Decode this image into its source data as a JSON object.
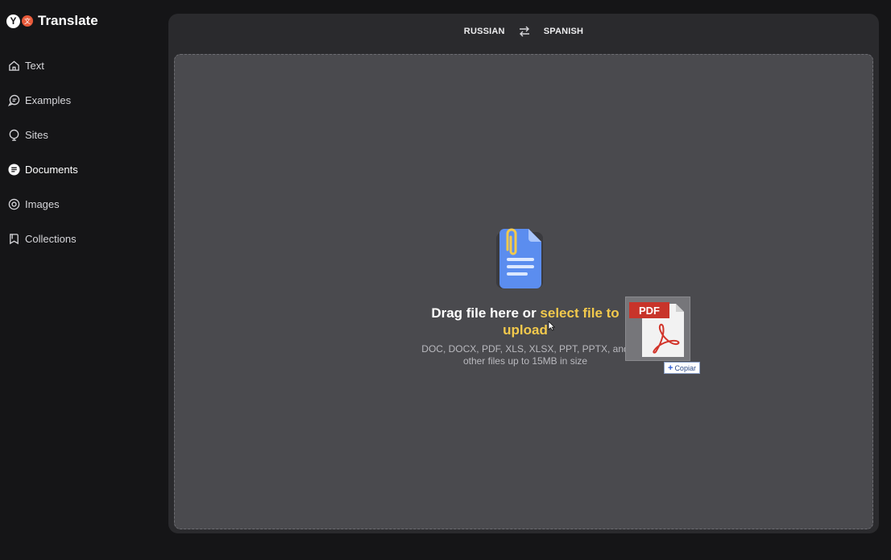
{
  "brand": {
    "title": "Translate",
    "logo_letter": "Y",
    "logo_badge": "文"
  },
  "nav": {
    "items": [
      {
        "label": "Text",
        "icon": "home-icon"
      },
      {
        "label": "Examples",
        "icon": "chat-icon"
      },
      {
        "label": "Sites",
        "icon": "globe-icon"
      },
      {
        "label": "Documents",
        "icon": "document-icon",
        "active": true
      },
      {
        "label": "Images",
        "icon": "camera-icon"
      },
      {
        "label": "Collections",
        "icon": "bookmark-icon"
      }
    ]
  },
  "languages": {
    "source": "RUSSIAN",
    "target": "SPANISH"
  },
  "dropzone": {
    "title_prefix": "Drag file here or ",
    "title_link": "select file to upload",
    "subtitle": "DOC, DOCX, PDF, XLS, XLSX, PPT, PPTX, and other files up to 15MB in size"
  },
  "drag_preview": {
    "file_label": "PDF",
    "copy_label": "Copiar"
  },
  "colors": {
    "accent_link": "#f2c94c",
    "pdf_red": "#c8342a",
    "doc_blue": "#5b8def"
  }
}
